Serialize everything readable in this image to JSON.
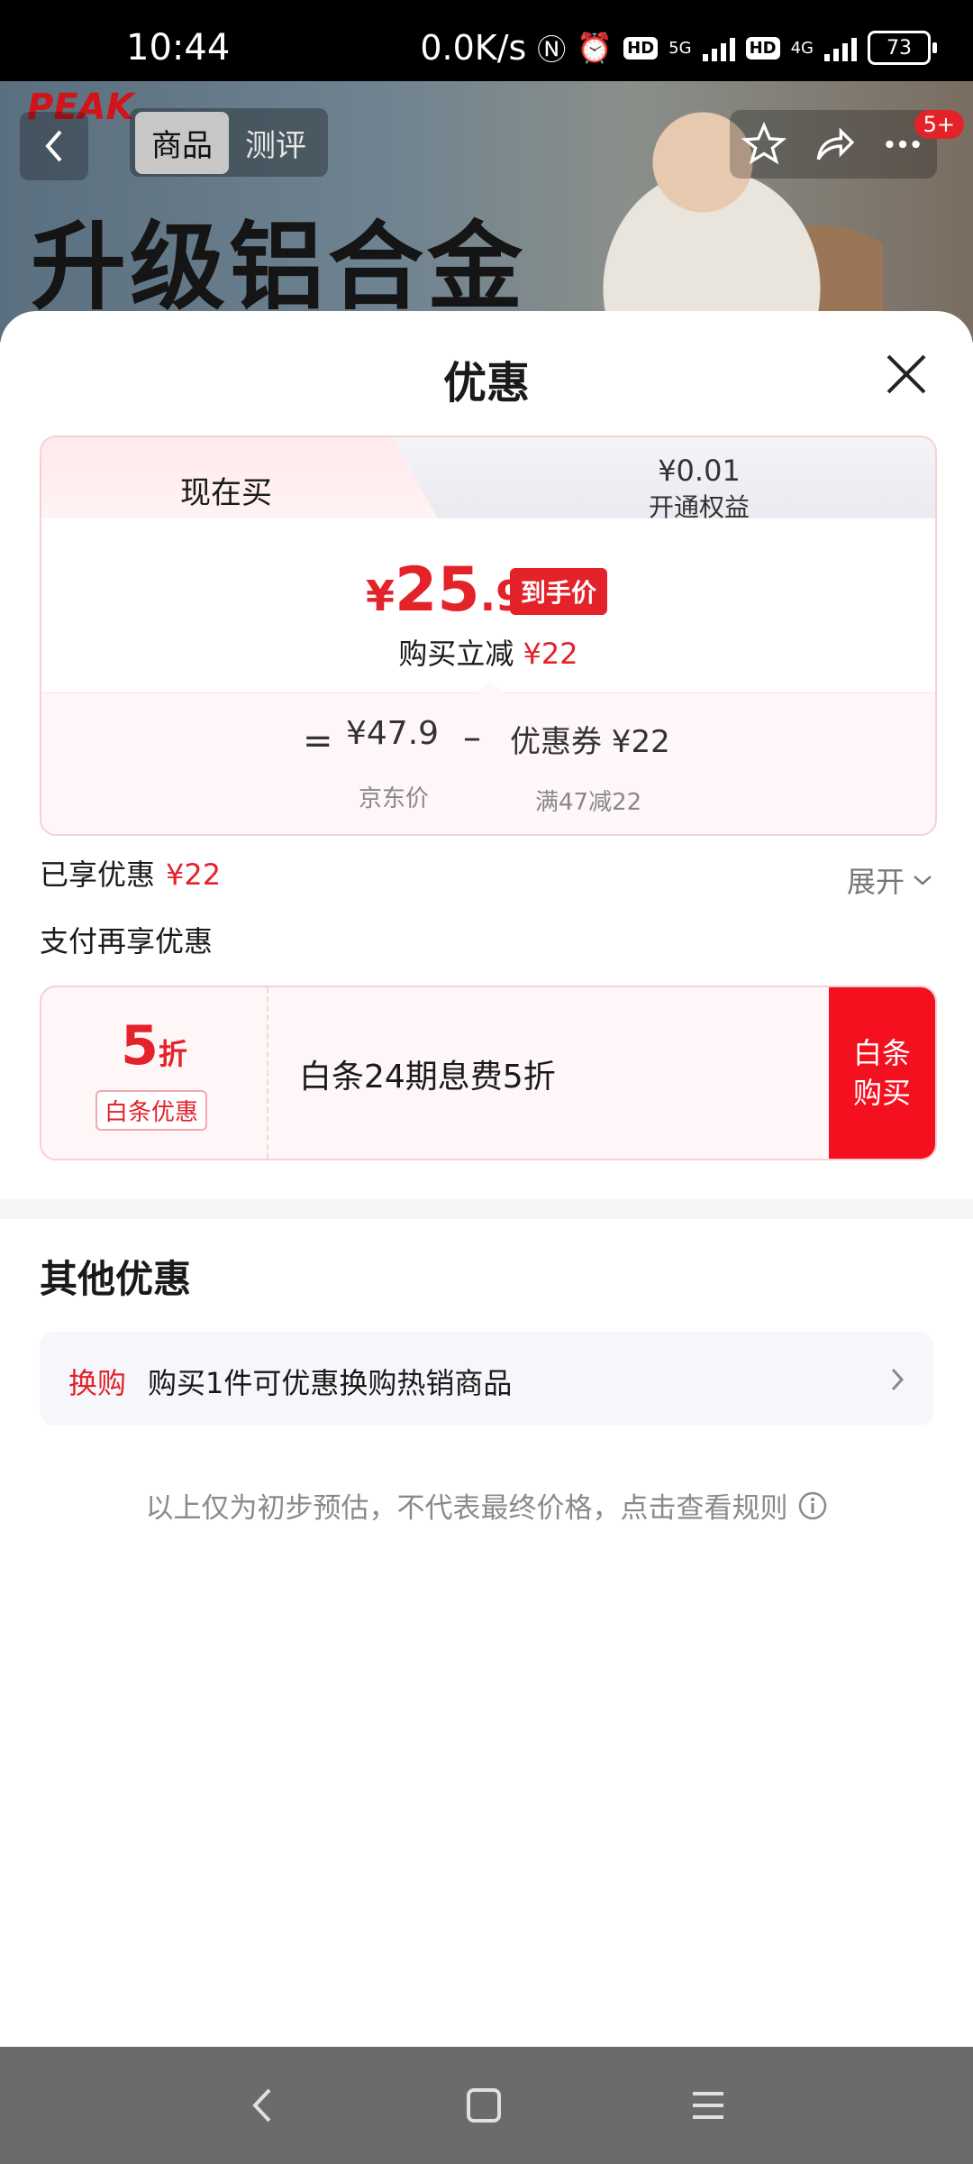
{
  "status": {
    "time": "10:44",
    "speed": "0.0K/s",
    "net1": "5G",
    "net2": "4G",
    "hd": "HD",
    "battery": "73"
  },
  "hero": {
    "logo": "PEAK",
    "headline": "升级铝合金",
    "tabs": [
      "商品",
      "测评"
    ],
    "badge": "5+"
  },
  "sheet": {
    "title": "优惠"
  },
  "price_card": {
    "tab_now": "现在买",
    "tab_member_price": "¥0.01",
    "tab_member_label": "开通权益",
    "final_symbol": "¥",
    "final_int": "25",
    "final_dec": ".9",
    "final_tag": "到手价",
    "instant_label": "购买立减",
    "instant_amount": "¥22",
    "eq": "=",
    "jd_price": "¥47.9",
    "jd_label": "京东价",
    "minus": "–",
    "coupon": "优惠券 ¥22",
    "coupon_rule": "满47减22"
  },
  "enjoyed": {
    "label": "已享优惠",
    "amount": "¥22",
    "expand": "展开"
  },
  "pay": {
    "title": "支付再享优惠",
    "discount_num": "5",
    "discount_unit": "折",
    "tag": "白条优惠",
    "text": "白条24期息费5折",
    "button": "白条\n购买"
  },
  "other": {
    "title": "其他优惠",
    "swap_tag": "换购",
    "swap_text": "购买1件可优惠换购热销商品"
  },
  "disclaimer": "以上仅为初步预估，不代表最终价格，点击查看规则"
}
